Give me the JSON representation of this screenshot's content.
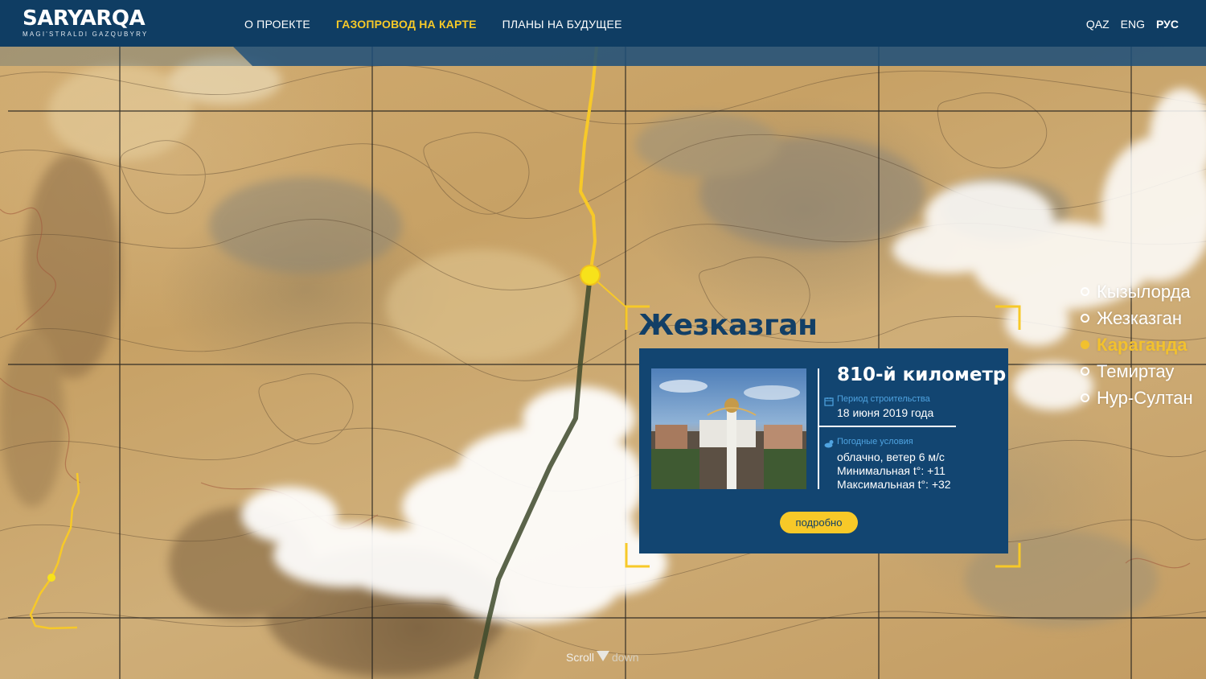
{
  "brand": {
    "title": "SARYARQA",
    "subtitle": "MAGI'STRALDI GAZQUBYRY"
  },
  "nav": {
    "items": [
      {
        "label": "О ПРОЕКТЕ",
        "active": false
      },
      {
        "label": "ГАЗОПРОВОД НА КАРТЕ",
        "active": true
      },
      {
        "label": "ПЛАНЫ НА БУДУЩЕЕ",
        "active": false
      }
    ]
  },
  "languages": [
    {
      "label": "QAZ",
      "active": false
    },
    {
      "label": "ENG",
      "active": false
    },
    {
      "label": "РУС",
      "active": true
    }
  ],
  "map": {
    "city_title": "Жезказган"
  },
  "card": {
    "kilometer": "810-й километр",
    "construction_label": "Период строительства",
    "construction_value": "18 июня 2019 года",
    "weather_label": "Погодные условия",
    "weather_line1": "облачно, ветер 6 м/с",
    "weather_line2": "Минимальная t°: +11",
    "weather_line3": "Максимальная t°: +32",
    "more_label": "подробно"
  },
  "cities": [
    {
      "name": "Кызылорда",
      "active": false
    },
    {
      "name": "Жезказган",
      "active": false
    },
    {
      "name": "Караганда",
      "active": true
    },
    {
      "name": "Темиртау",
      "active": false
    },
    {
      "name": "Нур-Султан",
      "active": false
    }
  ],
  "scroll_hint": {
    "word1": "Scroll",
    "word2": "down"
  },
  "colors": {
    "header": "#0f3d63",
    "accent_yellow": "#f7c928",
    "card": "#124571",
    "city_title": "#123f66"
  }
}
